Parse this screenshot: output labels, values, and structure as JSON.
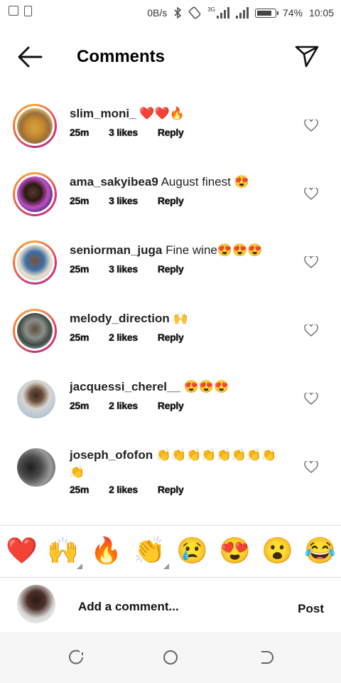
{
  "status": {
    "speed": "0B/s",
    "network": "3G",
    "battery": "74%",
    "time": "10:05"
  },
  "header": {
    "title": "Comments"
  },
  "comments": [
    {
      "username": "slim_moni_",
      "text": "❤️❤️🔥",
      "time": "25m",
      "likes": "3 likes",
      "reply": "Reply"
    },
    {
      "username": "ama_sakyibea9",
      "text": "August finest 😍",
      "time": "25m",
      "likes": "3 likes",
      "reply": "Reply"
    },
    {
      "username": "seniorman_juga",
      "text": "Fine wine😍😍😍",
      "time": "25m",
      "likes": "3 likes",
      "reply": "Reply"
    },
    {
      "username": "melody_direction",
      "text": "🙌",
      "time": "25m",
      "likes": "2 likes",
      "reply": "Reply"
    },
    {
      "username": "jacquessi_cherel__",
      "text": "😍😍😍",
      "time": "25m",
      "likes": "2 likes",
      "reply": "Reply"
    },
    {
      "username": "joseph_ofofon",
      "text": "👏👏👏👏👏👏👏👏👏",
      "time": "25m",
      "likes": "2 likes",
      "reply": "Reply"
    }
  ],
  "reactions": [
    "❤️",
    "🙌",
    "🔥",
    "👏",
    "😢",
    "😍",
    "😮",
    "😂"
  ],
  "composer": {
    "placeholder": "Add a comment...",
    "post": "Post"
  },
  "icons": {
    "back": "back-arrow-icon",
    "send": "paper-plane-icon",
    "heart": "heart-outline-icon"
  }
}
